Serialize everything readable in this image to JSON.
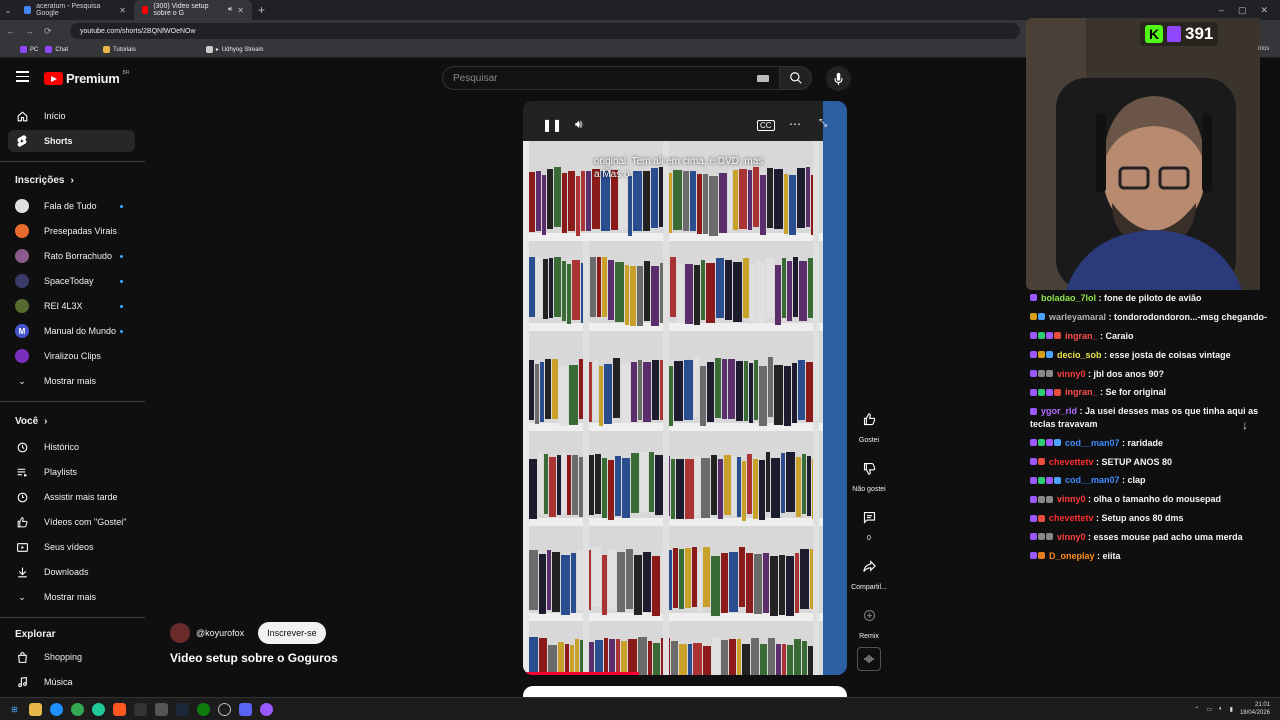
{
  "browser": {
    "tabs": [
      {
        "title": "aceratum - Pesquisa Google",
        "active": false
      },
      {
        "title": "(300) Video setup sobre o G",
        "active": true
      }
    ],
    "url": "youtube.com/shorts/2BQNfWOeNOw",
    "bookmarks": [
      "PC",
      "Chat",
      "Tutoriais",
      "Udhyog Stream"
    ]
  },
  "header": {
    "logo_text": "Premium",
    "region": "BR",
    "search_placeholder": "Pesquisar"
  },
  "sidebar": {
    "main": [
      {
        "label": "Início",
        "icon": "home-icon"
      },
      {
        "label": "Shorts",
        "icon": "shorts-icon",
        "active": true
      }
    ],
    "subscriptions_heading": "Inscrições",
    "subscriptions": [
      {
        "label": "Fala de Tudo",
        "dot": true,
        "color": "#e0e0e0"
      },
      {
        "label": "Presepadas Virais",
        "dot": false,
        "color": "#e86b2d"
      },
      {
        "label": "Rato Borrachudo",
        "dot": true,
        "color": "#8a5a8a"
      },
      {
        "label": "SpaceToday",
        "dot": true,
        "color": "#3a3a6a"
      },
      {
        "label": "REI 4L3X",
        "dot": true,
        "color": "#556b2f"
      },
      {
        "label": "Manual do Mundo",
        "dot": true,
        "color": "#4455cc"
      },
      {
        "label": "Viralizou Clips",
        "dot": false,
        "color": "#7b2fbe"
      }
    ],
    "show_more": "Mostrar mais",
    "you_heading": "Você",
    "you": [
      {
        "label": "Histórico",
        "icon": "history-icon"
      },
      {
        "label": "Playlists",
        "icon": "playlist-icon"
      },
      {
        "label": "Assistir mais tarde",
        "icon": "watch-later-icon"
      },
      {
        "label": "Vídeos com \"Gostei\"",
        "icon": "like-icon"
      },
      {
        "label": "Seus vídeos",
        "icon": "your-videos-icon"
      },
      {
        "label": "Downloads",
        "icon": "download-icon"
      }
    ],
    "show_more_2": "Mostrar mais",
    "explore_heading": "Explorar",
    "explore": [
      {
        "label": "Shopping",
        "icon": "shopping-icon"
      },
      {
        "label": "Música",
        "icon": "music-icon"
      }
    ]
  },
  "video": {
    "caption": "original. Tem ali em cima, é DVD, mas a Mas o",
    "cc_label": "CC"
  },
  "actions": {
    "like": "Gostei",
    "dislike": "Não gostei",
    "comments": "0",
    "share": "Compartil...",
    "remix": "Remix"
  },
  "channel": {
    "handle": "@koyurofox",
    "subscribe": "Inscrever-se",
    "title": "Video setup sobre o Goguros"
  },
  "stream": {
    "viewers": "391",
    "side_label": "ntos"
  },
  "chat": [
    {
      "user": "boladao_7lol",
      "color": "#8ee24c",
      "text": "fone de piloto de avião",
      "badges": [
        "#9b59ff"
      ]
    },
    {
      "user": "warleyamaral",
      "color": "#b0b0b0",
      "text": "tondorodondoron...-msg chegando-",
      "badges": [
        "#d4a017",
        "#4aa3ff"
      ]
    },
    {
      "user": "ingran_",
      "color": "#ff4d4d",
      "text": "Caraio",
      "badges": [
        "#9b59ff",
        "#2ecc71",
        "#9b59ff",
        "#e74c3c"
      ]
    },
    {
      "user": "decio_sob",
      "color": "#e6e64c",
      "text": "esse josta de coisas vintage",
      "badges": [
        "#9b59ff",
        "#d4a017",
        "#4aa3ff"
      ]
    },
    {
      "user": "vinny0",
      "color": "#ff3b3b",
      "text": "jbl dos anos 90?",
      "badges": [
        "#9b59ff",
        "#888888",
        "#888888"
      ]
    },
    {
      "user": "ingran_",
      "color": "#ff4d4d",
      "text": "Se for original",
      "badges": [
        "#9b59ff",
        "#2ecc71",
        "#9b59ff",
        "#e74c3c"
      ]
    },
    {
      "user": "ygor_rld",
      "color": "#b46cff",
      "text": "Ja usei desses mas os que tinha aqui as teclas travavam",
      "badges": [
        "#9b59ff"
      ]
    },
    {
      "user": "cod__man07",
      "color": "#3d8bff",
      "text": "raridade",
      "badges": [
        "#9b59ff",
        "#2ecc71",
        "#9b59ff",
        "#4aa3ff"
      ]
    },
    {
      "user": "chevettetv",
      "color": "#ff2e2e",
      "text": "SETUP ANOS 80",
      "badges": [
        "#9b59ff",
        "#e74c3c"
      ]
    },
    {
      "user": "cod__man07",
      "color": "#3d8bff",
      "text": "clap",
      "badges": [
        "#9b59ff",
        "#2ecc71",
        "#9b59ff",
        "#4aa3ff"
      ]
    },
    {
      "user": "vinny0",
      "color": "#ff3b3b",
      "text": "olha o tamanho do mousepad",
      "badges": [
        "#9b59ff",
        "#888888",
        "#888888"
      ]
    },
    {
      "user": "chevettetv",
      "color": "#ff2e2e",
      "text": "Setup anos 80 dms",
      "badges": [
        "#9b59ff",
        "#e74c3c"
      ]
    },
    {
      "user": "vinny0",
      "color": "#ff3b3b",
      "text": "esses mouse pad acho uma merda",
      "badges": [
        "#9b59ff",
        "#888888",
        "#888888"
      ]
    },
    {
      "user": "D_oneplay",
      "color": "#ff8c1a",
      "text": "eiita",
      "badges": [
        "#9b59ff",
        "#e67e22"
      ]
    }
  ],
  "taskbar": {
    "time": "21:01",
    "date": "18/04/2026"
  }
}
